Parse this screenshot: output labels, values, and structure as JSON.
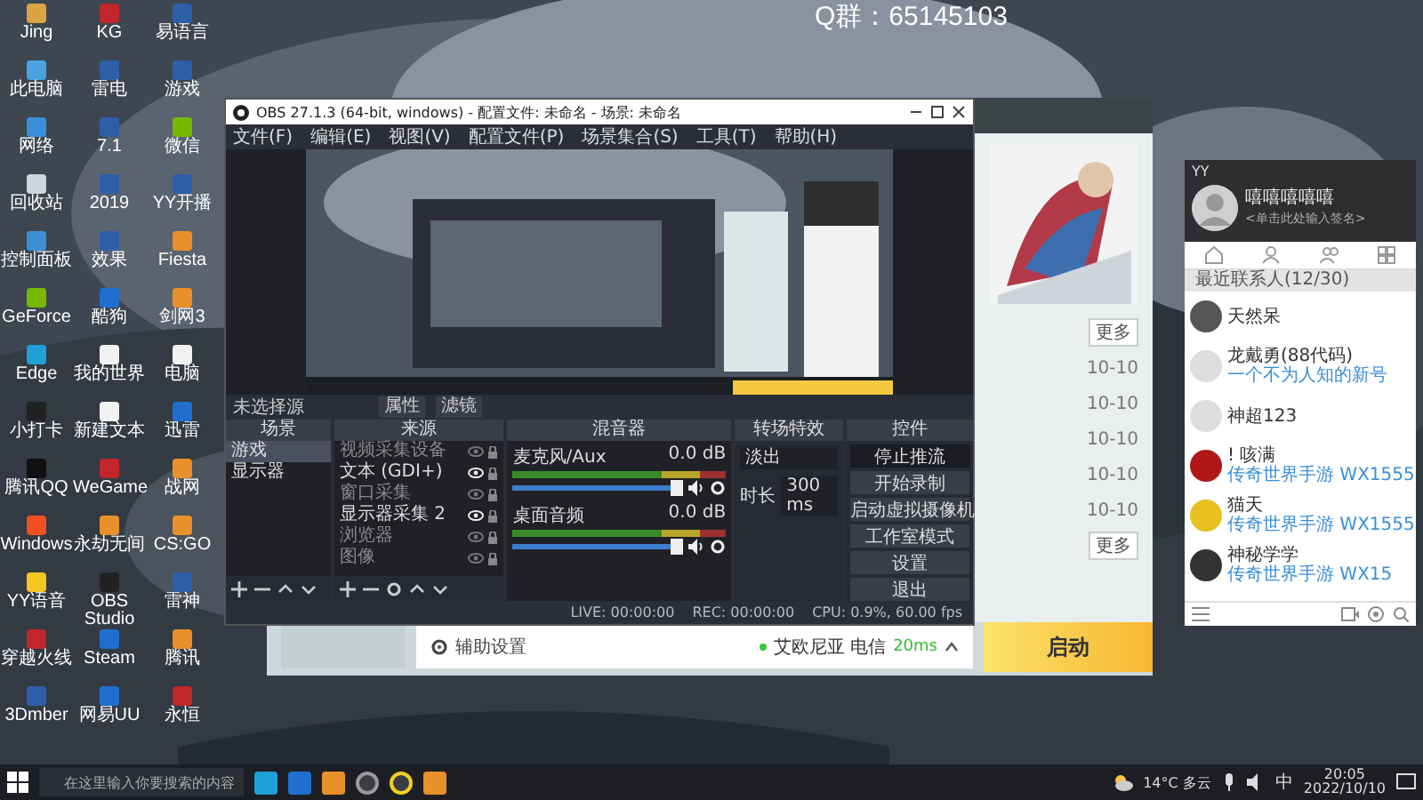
{
  "overlay_text": "Q群：65145103",
  "desktop_icons": [
    {
      "label": "Jing",
      "kind": "person"
    },
    {
      "label": "此电脑",
      "kind": "pc"
    },
    {
      "label": "网络",
      "kind": "globe"
    },
    {
      "label": "回收站",
      "kind": "bin"
    },
    {
      "label": "控制面板",
      "kind": "panel"
    },
    {
      "label": "GeForce",
      "kind": "green"
    },
    {
      "label": "Edge",
      "kind": "edge"
    },
    {
      "label": "小打卡",
      "kind": "ring"
    },
    {
      "label": "腾讯QQ",
      "kind": "qq"
    },
    {
      "label": "Windows",
      "kind": "win"
    },
    {
      "label": "YY语音",
      "kind": "yy"
    },
    {
      "label": "穿越火线",
      "kind": "red"
    },
    {
      "label": "3Dmber",
      "kind": "app"
    },
    {
      "label": "KG",
      "kind": "red"
    },
    {
      "label": "雷电",
      "kind": "app"
    },
    {
      "label": "7.1",
      "kind": "app"
    },
    {
      "label": "2019",
      "kind": "app"
    },
    {
      "label": "效果",
      "kind": "app"
    },
    {
      "label": "酷狗",
      "kind": "blue"
    },
    {
      "label": "我的世界",
      "kind": "doc"
    },
    {
      "label": "新建文本",
      "kind": "doc"
    },
    {
      "label": "WeGame",
      "kind": "red"
    },
    {
      "label": "永劫无间",
      "kind": "orange"
    },
    {
      "label": "OBS Studio",
      "kind": "ring"
    },
    {
      "label": "Steam",
      "kind": "blue"
    },
    {
      "label": "网易UU",
      "kind": "blue"
    },
    {
      "label": "易语言",
      "kind": "app"
    },
    {
      "label": "游戏",
      "kind": "app"
    },
    {
      "label": "微信",
      "kind": "green"
    },
    {
      "label": "YY开播",
      "kind": "app"
    },
    {
      "label": "Fiesta",
      "kind": "orange"
    },
    {
      "label": "剑网3",
      "kind": "orange"
    },
    {
      "label": "电脑",
      "kind": "doc"
    },
    {
      "label": "迅雷",
      "kind": "blue"
    },
    {
      "label": "战网",
      "kind": "orange"
    },
    {
      "label": "CS:GO",
      "kind": "orange"
    },
    {
      "label": "雷神",
      "kind": "app"
    },
    {
      "label": "腾讯",
      "kind": "orange"
    },
    {
      "label": "永恒",
      "kind": "red"
    }
  ],
  "launcher": {
    "side_rows": [
      {
        "title": "更多",
        "kind": "more"
      },
      {
        "title": "10-10",
        "kind": "date"
      },
      {
        "title": "10-10",
        "kind": "date"
      },
      {
        "title": "10-10",
        "kind": "date"
      },
      {
        "title": "10-10",
        "kind": "date"
      },
      {
        "title": "10-10",
        "kind": "date"
      },
      {
        "title": "更多",
        "kind": "more"
      }
    ],
    "assist": "辅助设置",
    "server": "艾欧尼亚 电信",
    "ping": "20ms",
    "start_button": "启动"
  },
  "obs": {
    "title": "OBS 27.1.3 (64-bit, windows) - 配置文件: 未命名 - 场景: 未命名",
    "menu": [
      "文件(F)",
      "编辑(E)",
      "视图(V)",
      "配置文件(P)",
      "场景集合(S)",
      "工具(T)",
      "帮助(H)"
    ],
    "source_label": "未选择源",
    "properties_button": "属性",
    "filters_button": "滤镜",
    "scenes": {
      "title": "场景",
      "items": [
        {
          "name": "游戏",
          "selected": true
        },
        {
          "name": "显示器",
          "selected": false
        }
      ]
    },
    "sources": {
      "title": "来源",
      "items": [
        {
          "name": "视频采集设备",
          "visible": false
        },
        {
          "name": "文本 (GDI+)",
          "visible": true
        },
        {
          "name": "窗口采集",
          "visible": false
        },
        {
          "name": "显示器采集 2",
          "visible": true
        },
        {
          "name": "浏览器",
          "visible": false
        },
        {
          "name": "图像",
          "visible": false
        }
      ]
    },
    "mixer": {
      "title": "混音器",
      "channels": [
        {
          "name": "麦克风/Aux",
          "reading": "0.0 dB",
          "level": 1.0
        },
        {
          "name": "桌面音频",
          "reading": "0.0 dB",
          "level": 1.0
        }
      ]
    },
    "transitions": {
      "title": "转场特效",
      "selected": "淡出",
      "duration_label": "时长",
      "duration": "300 ms"
    },
    "controls": {
      "title": "控件",
      "buttons": [
        {
          "label": "停止推流",
          "active": true
        },
        {
          "label": "开始录制",
          "active": false
        },
        {
          "label": "启动虚拟摄像机",
          "active": false
        },
        {
          "label": "工作室模式",
          "active": false
        },
        {
          "label": "设置",
          "active": false
        },
        {
          "label": "退出",
          "active": false
        }
      ]
    },
    "status": [
      "LIVE: 00:00:00",
      "REC: 00:00:00",
      "CPU: 0.9%, 60.00 fps"
    ]
  },
  "chat": {
    "app": "YY",
    "nickname": "嘻嘻嘻嘻嘻",
    "signature": "<单击此处输入签名>",
    "group": "最近联系人(12/30)",
    "contacts": [
      {
        "name": "天然呆",
        "color": "#555555"
      },
      {
        "name": "龙戴勇(88代码)",
        "message": "一个不为人知的新号",
        "color": "#dddddd"
      },
      {
        "name": "神超123",
        "color": "#dddddd"
      },
      {
        "name": "! 咳满",
        "message": "传奇世界手游 WX1555",
        "color": "#b01818"
      },
      {
        "name": "猫天",
        "message": "传奇世界手游 WX1555",
        "color": "#e8c020"
      },
      {
        "name": "神秘学学",
        "message": "传奇世界手游 WX15",
        "color": "#333333"
      }
    ]
  },
  "taskbar": {
    "search_placeholder": "在这里输入你要搜索的内容",
    "apps": [
      {
        "kind": "edge"
      },
      {
        "kind": "blue"
      },
      {
        "kind": "orange"
      },
      {
        "kind": "obs"
      },
      {
        "kind": "ring"
      },
      {
        "kind": "orange"
      }
    ],
    "weather": "14°C 多云",
    "ime": "中",
    "time": "20:05",
    "date": "2022/10/10"
  }
}
